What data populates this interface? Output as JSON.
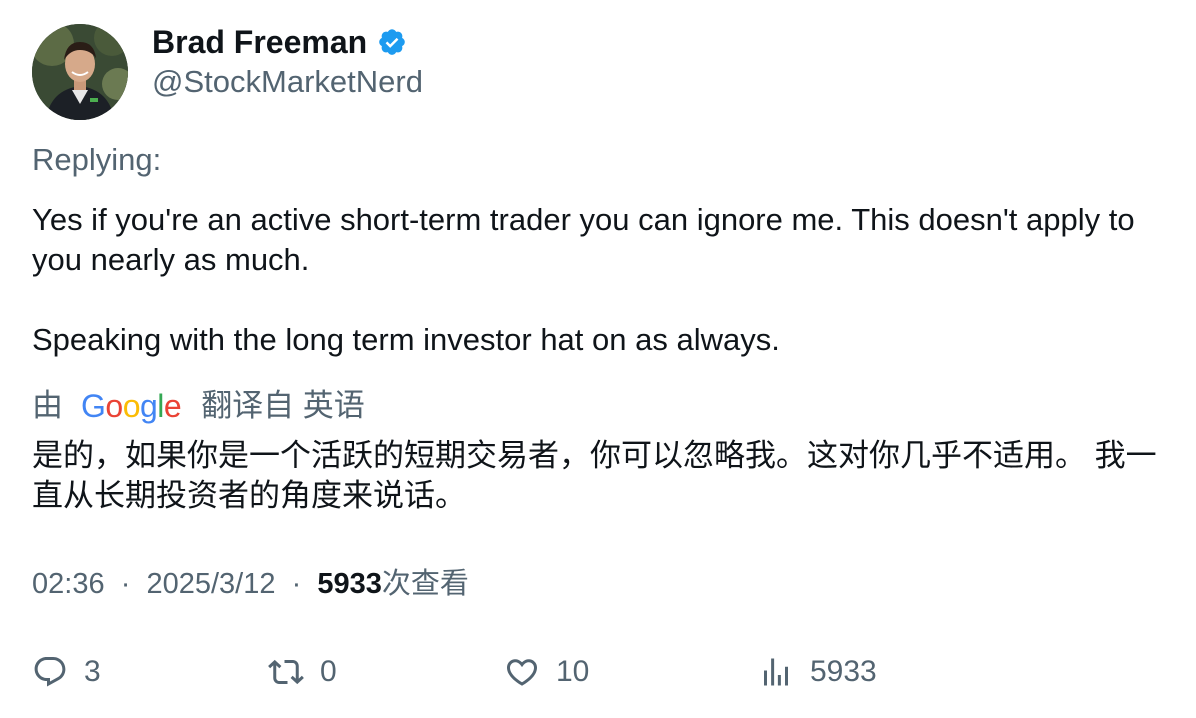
{
  "author": {
    "display_name": "Brad Freeman",
    "handle": "@StockMarketNerd",
    "verified": true,
    "verified_color": "#1d9bf0"
  },
  "replying_label": "Replying:",
  "tweet": {
    "paragraphs": [
      "Yes if you're an active short-term trader you can ignore me. This doesn't apply to you nearly as much.",
      "Speaking with the long term investor hat on as always."
    ]
  },
  "translation": {
    "prefix": "由",
    "provider": "Google",
    "suffix": "翻译自 英语",
    "text": "是的，如果你是一个活跃的短期交易者，你可以忽略我。这对你几乎不适用。 我一直从长期投资者的角度来说话。"
  },
  "meta": {
    "time": "02:36",
    "separator": "·",
    "date": "2025/3/12",
    "views_count": "5933",
    "views_label": "次查看"
  },
  "actions": {
    "replies": "3",
    "retweets": "0",
    "likes": "10",
    "views": "5933"
  },
  "colors": {
    "text_primary": "#0f1419",
    "text_secondary": "#536471",
    "google_blue": "#4285F4",
    "google_red": "#EA4335",
    "google_yellow": "#FBBC05",
    "google_green": "#34A853"
  }
}
